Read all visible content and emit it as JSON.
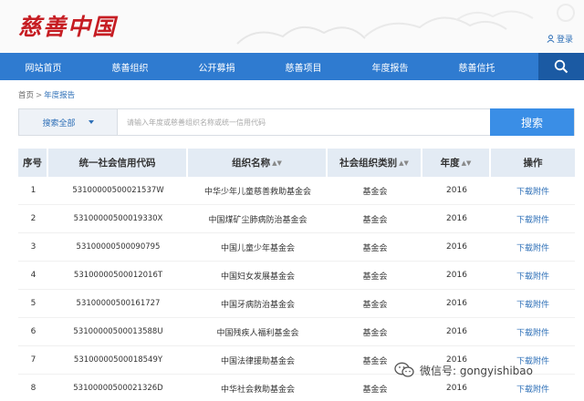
{
  "header": {
    "logo_text": "慈善中国",
    "login_label": "登录"
  },
  "nav": {
    "items": [
      {
        "label": "网站首页"
      },
      {
        "label": "慈善组织"
      },
      {
        "label": "公开募捐"
      },
      {
        "label": "慈善项目"
      },
      {
        "label": "年度报告"
      },
      {
        "label": "慈善信托"
      }
    ]
  },
  "breadcrumb": {
    "home": "首页",
    "separator": ">",
    "current": "年度报告"
  },
  "search": {
    "select_value": "搜索全部",
    "placeholder": "请输入年度或慈善组织名称或统一信用代码",
    "button_label": "搜索"
  },
  "table": {
    "headers": {
      "index": "序号",
      "code": "统一社会信用代码",
      "name": "组织名称",
      "type": "社会组织类别",
      "year": "年度",
      "action": "操作"
    },
    "rows": [
      {
        "index": "1",
        "code": "53100000500021537W",
        "name": "中华少年儿童慈善救助基金会",
        "type": "基金会",
        "year": "2016",
        "action": "下载附件"
      },
      {
        "index": "2",
        "code": "53100000500019330X",
        "name": "中国煤矿尘肺病防治基金会",
        "type": "基金会",
        "year": "2016",
        "action": "下载附件"
      },
      {
        "index": "3",
        "code": "53100000500090795",
        "name": "中国儿童少年基金会",
        "type": "基金会",
        "year": "2016",
        "action": "下载附件"
      },
      {
        "index": "4",
        "code": "53100000500012016T",
        "name": "中国妇女发展基金会",
        "type": "基金会",
        "year": "2016",
        "action": "下载附件"
      },
      {
        "index": "5",
        "code": "53100000500161727",
        "name": "中国牙病防治基金会",
        "type": "基金会",
        "year": "2016",
        "action": "下载附件"
      },
      {
        "index": "6",
        "code": "53100000500013588U",
        "name": "中国残疾人福利基金会",
        "type": "基金会",
        "year": "2016",
        "action": "下载附件"
      },
      {
        "index": "7",
        "code": "53100000500018549Y",
        "name": "中国法律援助基金会",
        "type": "基金会",
        "year": "2016",
        "action": "下载附件"
      },
      {
        "index": "8",
        "code": "53100000500021326D",
        "name": "中华社会救助基金会",
        "type": "基金会",
        "year": "2016",
        "action": "下载附件"
      }
    ]
  },
  "watermark": {
    "text": "微信号: gongyishibao"
  },
  "colors": {
    "brand_red": "#c61d23",
    "nav_blue": "#2f7bd0",
    "nav_search_blue": "#1b5aa3",
    "link_blue": "#2d6fb7",
    "header_row_bg": "#e3ebf4"
  },
  "icons": {
    "login": "user-icon",
    "nav_search": "search-icon",
    "select": "caret-down-icon",
    "sort": "sort-icon",
    "watermark": "wechat-icon"
  }
}
